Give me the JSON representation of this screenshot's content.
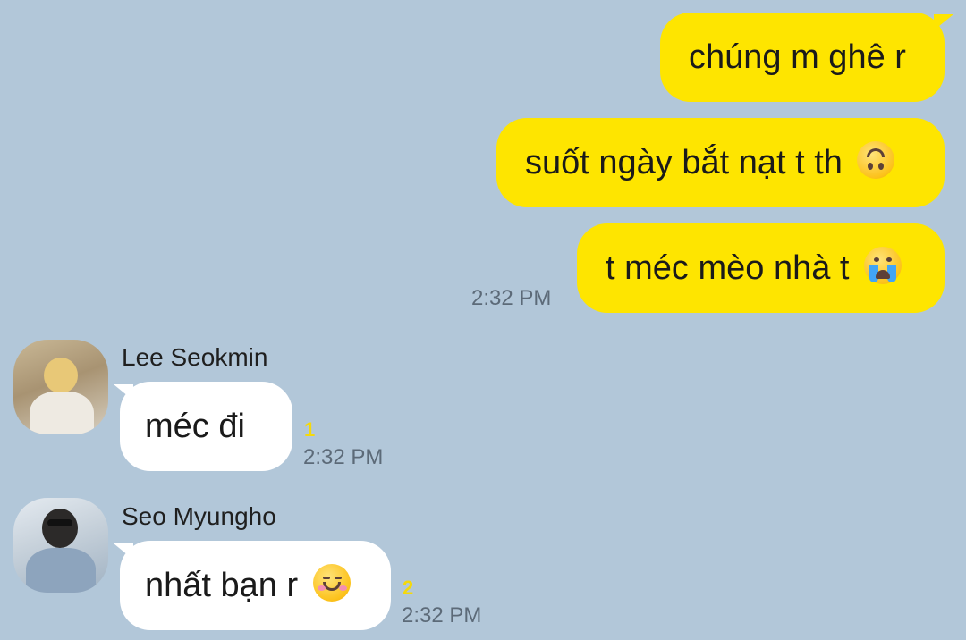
{
  "outgoing": {
    "messages": [
      {
        "text": "chúng m ghê r",
        "emoji": null
      },
      {
        "text": "suốt ngày bắt nạt t th",
        "emoji": "upside-down-face-icon"
      },
      {
        "text": "t méc mèo nhà t",
        "emoji": "crying-face-icon"
      }
    ],
    "time": "2:32 PM",
    "bubble_color": "#fee500"
  },
  "incoming": [
    {
      "sender": "Lee Seokmin",
      "text": "méc đi",
      "emoji": null,
      "unread": "1",
      "time": "2:32 PM"
    },
    {
      "sender": "Seo Myungho",
      "text": "nhất bạn r",
      "emoji": "smiling-face-icon",
      "unread": "2",
      "time": "2:32 PM"
    }
  ],
  "colors": {
    "background": "#b2c7d9",
    "incoming_bubble": "#ffffff",
    "unread_count": "#f5d90a"
  }
}
